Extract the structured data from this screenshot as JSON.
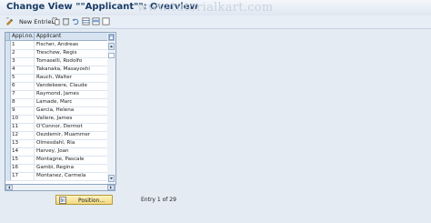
{
  "window": {
    "title": "Change View \"\"Applicant\"\": Overview"
  },
  "watermark": "www.tutorialkart.com",
  "toolbar": {
    "new_entries_label": "New Entries",
    "icons": [
      "display-change-icon",
      "new-entries-icon",
      "copy-icon",
      "delete-icon",
      "undo-icon",
      "select-all-icon",
      "select-block-icon",
      "deselect-all-icon"
    ]
  },
  "table": {
    "columns": [
      "Appl.no.",
      "Applicant"
    ],
    "rows": [
      {
        "no": "1",
        "applicant": "Fischer, Andreas"
      },
      {
        "no": "2",
        "applicant": "Treschow, Regis"
      },
      {
        "no": "3",
        "applicant": "Tomaselli, Rodolfo"
      },
      {
        "no": "4",
        "applicant": "Takanaka, Masayoshi"
      },
      {
        "no": "5",
        "applicant": "Rauch, Walter"
      },
      {
        "no": "6",
        "applicant": "Vandekeere, Claude"
      },
      {
        "no": "7",
        "applicant": "Raymond, James"
      },
      {
        "no": "8",
        "applicant": "Lamade, Marc"
      },
      {
        "no": "9",
        "applicant": "Garcia, Helena"
      },
      {
        "no": "10",
        "applicant": "Vallere, James"
      },
      {
        "no": "11",
        "applicant": "O'Connor, Dermot"
      },
      {
        "no": "12",
        "applicant": "Oezdemir, Muammer"
      },
      {
        "no": "13",
        "applicant": "Olmesdahl, Ria"
      },
      {
        "no": "14",
        "applicant": "Harvey, Joan"
      },
      {
        "no": "15",
        "applicant": "Montagne, Pascale"
      },
      {
        "no": "16",
        "applicant": "Gambi, Regina"
      },
      {
        "no": "17",
        "applicant": "Montanez, Carmela"
      }
    ]
  },
  "footer": {
    "position_button_label": "Position...",
    "entry_info": "Entry 1 of 29"
  }
}
